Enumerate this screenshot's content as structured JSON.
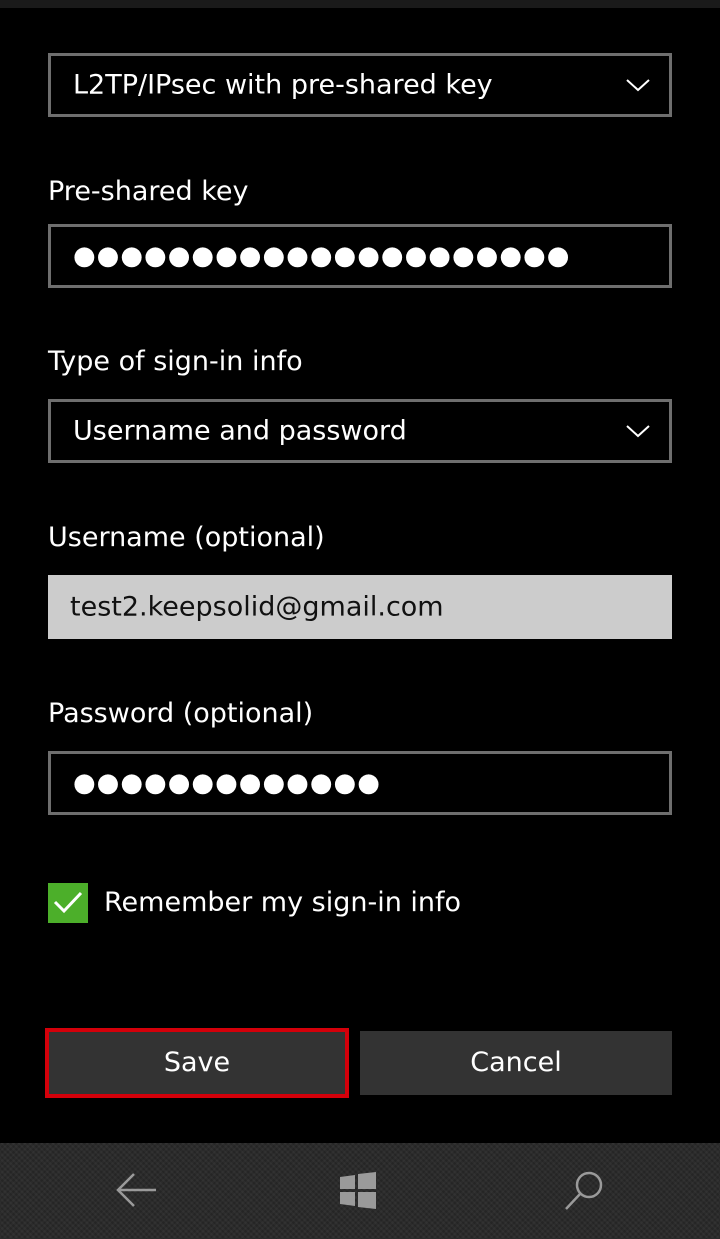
{
  "vpn_type": {
    "selected": "L2TP/IPsec with pre-shared key",
    "icon": "chevron-down-icon"
  },
  "pre_shared_key": {
    "label": "Pre-shared key",
    "value_masked": "●●●●●●●●●●●●●●●●●●●●●"
  },
  "sign_in_type": {
    "label": "Type of sign-in info",
    "selected": "Username and password",
    "icon": "chevron-down-icon"
  },
  "username": {
    "label": "Username (optional)",
    "value": "test2.keepsolid@gmail.com"
  },
  "password": {
    "label": "Password (optional)",
    "value_masked": "●●●●●●●●●●●●●"
  },
  "remember": {
    "label": "Remember my sign-in info",
    "checked": true,
    "color": "#4caf2a"
  },
  "buttons": {
    "save_label": "Save",
    "cancel_label": "Cancel",
    "highlight_color": "#d4000a"
  },
  "navbar": {
    "icons": [
      "back-arrow-icon",
      "windows-start-icon",
      "search-icon"
    ]
  }
}
